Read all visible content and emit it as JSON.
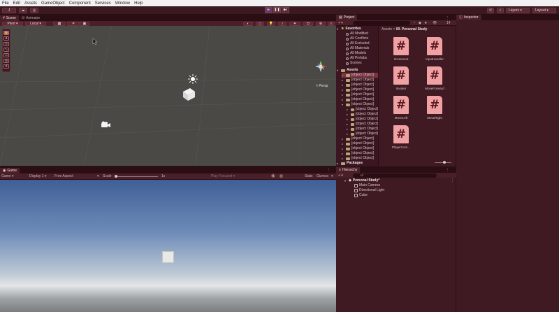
{
  "menu": [
    "File",
    "Edit",
    "Assets",
    "GameObject",
    "Component",
    "Services",
    "Window",
    "Help"
  ],
  "toolbar": {
    "account_label": "J",
    "layers_label": "Layers",
    "layout_label": "Layout",
    "play_icons": [
      "▶",
      "❚❚",
      "▶|"
    ]
  },
  "scene": {
    "tabs": [
      "Scene",
      "Animator"
    ],
    "pivot_label": "Pivot",
    "local_label": "Local",
    "persp_label": "< Persp"
  },
  "game": {
    "tab": "Game",
    "mode_label": "Game",
    "display_label": "Display 1",
    "aspect_label": "Free Aspect",
    "scale_label": "Scale",
    "scale_value": "1x",
    "play_focused_label": "Play Focused",
    "stats_label": "Stats",
    "gizmos_label": "Gizmos"
  },
  "project": {
    "tab": "Project",
    "count_badge": "14",
    "breadcrumb_root": "Assets",
    "breadcrumb_current": "00. Personal Study",
    "favorites_header": "Favorites",
    "favorites": [
      "All Modified",
      "All Conflicts",
      "All Excluded",
      "All Materials",
      "All Models",
      "All Prefabs",
      "Scenes"
    ],
    "assets_header": "Assets",
    "assets": [
      {
        "label": "00. Personal St",
        "indent": 1,
        "selected": true
      },
      {
        "label": "01. Scenes",
        "indent": 1
      },
      {
        "label": "02. Scripts",
        "indent": 1
      },
      {
        "label": "03. Prefabs",
        "indent": 1
      },
      {
        "label": "04. Materials",
        "indent": 1
      },
      {
        "label": "05. Animations",
        "indent": 1
      },
      {
        "label": "06. Resources",
        "indent": 1
      },
      {
        "label": "Flappy Bird I",
        "indent": 2
      },
      {
        "label": "Font",
        "indent": 2
      },
      {
        "label": "Free Wood D",
        "indent": 2
      },
      {
        "label": "Planets of th",
        "indent": 2
      },
      {
        "label": "Sound",
        "indent": 2
      },
      {
        "label": "Starfield Sky",
        "indent": 2
      },
      {
        "label": "Editor",
        "indent": 1
      },
      {
        "label": "Flashlight",
        "indent": 1
      },
      {
        "label": "Free Stylized S",
        "indent": 1
      },
      {
        "label": "Scenes",
        "indent": 1
      },
      {
        "label": "TextMesh Pro",
        "indent": 1
      }
    ],
    "packages_header": "Packages",
    "scripts": [
      "IComment",
      "InputHandler",
      "Invoker",
      "MoveForward",
      "MoveLeft",
      "MoveRight",
      "PlayerCom..."
    ]
  },
  "hierarchy": {
    "tab": "Hierarchy",
    "search_placeholder": "All",
    "scene_name": "Personal Study*",
    "objects": [
      "Main Camera",
      "Directional Light",
      "Cube"
    ]
  },
  "inspector": {
    "tab": "Inspector"
  }
}
